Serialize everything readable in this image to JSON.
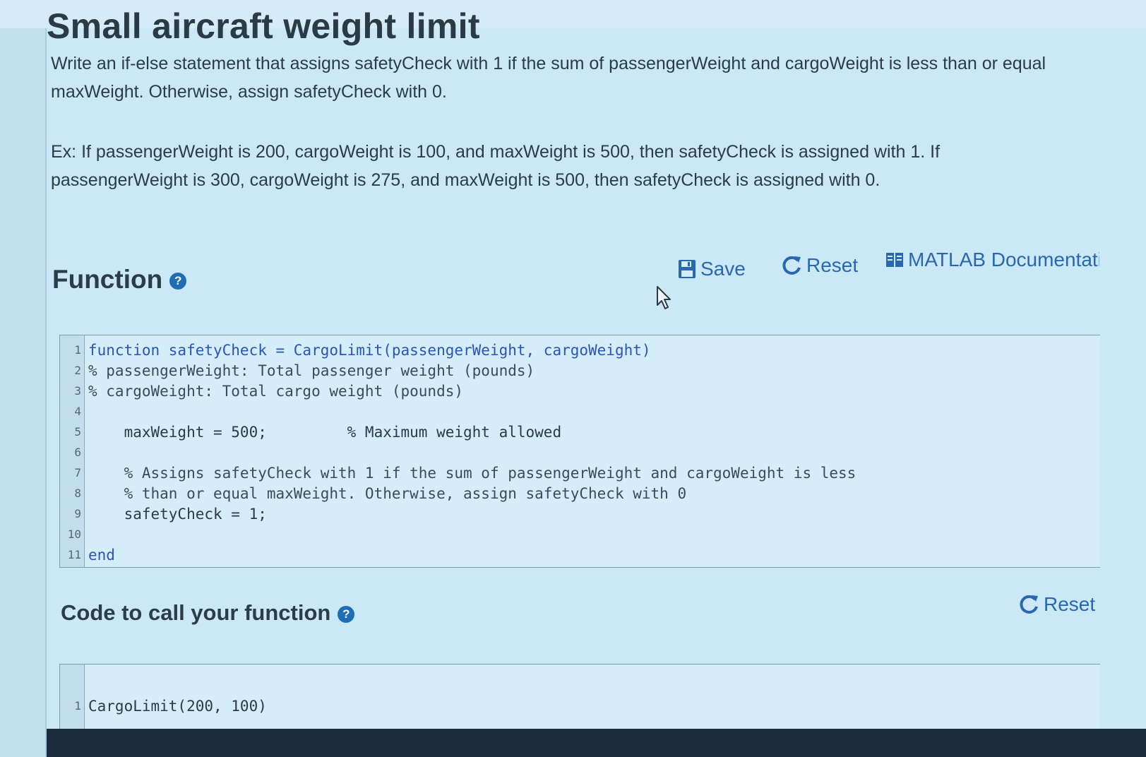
{
  "problem": {
    "title": "Small aircraft weight limit",
    "description": "Write an if-else statement that assigns safetyCheck with 1 if the sum of passengerWeight and cargoWeight is less than or equal maxWeight. Otherwise, assign safetyCheck with 0.",
    "example": "Ex: If passengerWeight is 200, cargoWeight is 100, and maxWeight is 500, then safetyCheck is assigned with 1. If passengerWeight is 300, cargoWeight is 275, and maxWeight is 500, then safetyCheck is assigned with 0."
  },
  "function_section": {
    "title": "Function",
    "help_icon": "question-circle-icon",
    "help_glyph": "?",
    "toolbar": {
      "save_label": "Save",
      "save_icon": "floppy-disk-icon",
      "reset_label": "Reset",
      "reset_icon": "refresh-icon",
      "docs_label": "MATLAB Documentation",
      "docs_icon": "book-icon"
    }
  },
  "function_code": {
    "lines": [
      {
        "num": "1",
        "text": "function safetyCheck = CargoLimit(passengerWeight, cargoWeight)"
      },
      {
        "num": "2",
        "text": "% passengerWeight: Total passenger weight (pounds)"
      },
      {
        "num": "3",
        "text": "% cargoWeight: Total cargo weight (pounds)"
      },
      {
        "num": "4",
        "text": ""
      },
      {
        "num": "5",
        "text": "    maxWeight = 500;         % Maximum weight allowed"
      },
      {
        "num": "6",
        "text": ""
      },
      {
        "num": "7",
        "text": "    % Assigns safetyCheck with 1 if the sum of passengerWeight and cargoWeight is less"
      },
      {
        "num": "8",
        "text": "    % than or equal maxWeight. Otherwise, assign safetyCheck with 0"
      },
      {
        "num": "9",
        "text": "    safetyCheck = 1;"
      },
      {
        "num": "10",
        "text": ""
      },
      {
        "num": "11",
        "text": "end"
      }
    ]
  },
  "call_section": {
    "title": "Code to call your function",
    "help_icon": "question-circle-icon",
    "help_glyph": "?",
    "reset_label": "Reset",
    "reset_icon": "refresh-icon"
  },
  "call_code": {
    "lines": [
      {
        "num": "1",
        "text": "CargoLimit(200, 100)"
      }
    ]
  },
  "colors": {
    "background": "#cbe8f7",
    "link": "#2967ae",
    "help_icon": "#1f6db7",
    "keyword": "#2a55b8",
    "text": "#2b3b48"
  }
}
